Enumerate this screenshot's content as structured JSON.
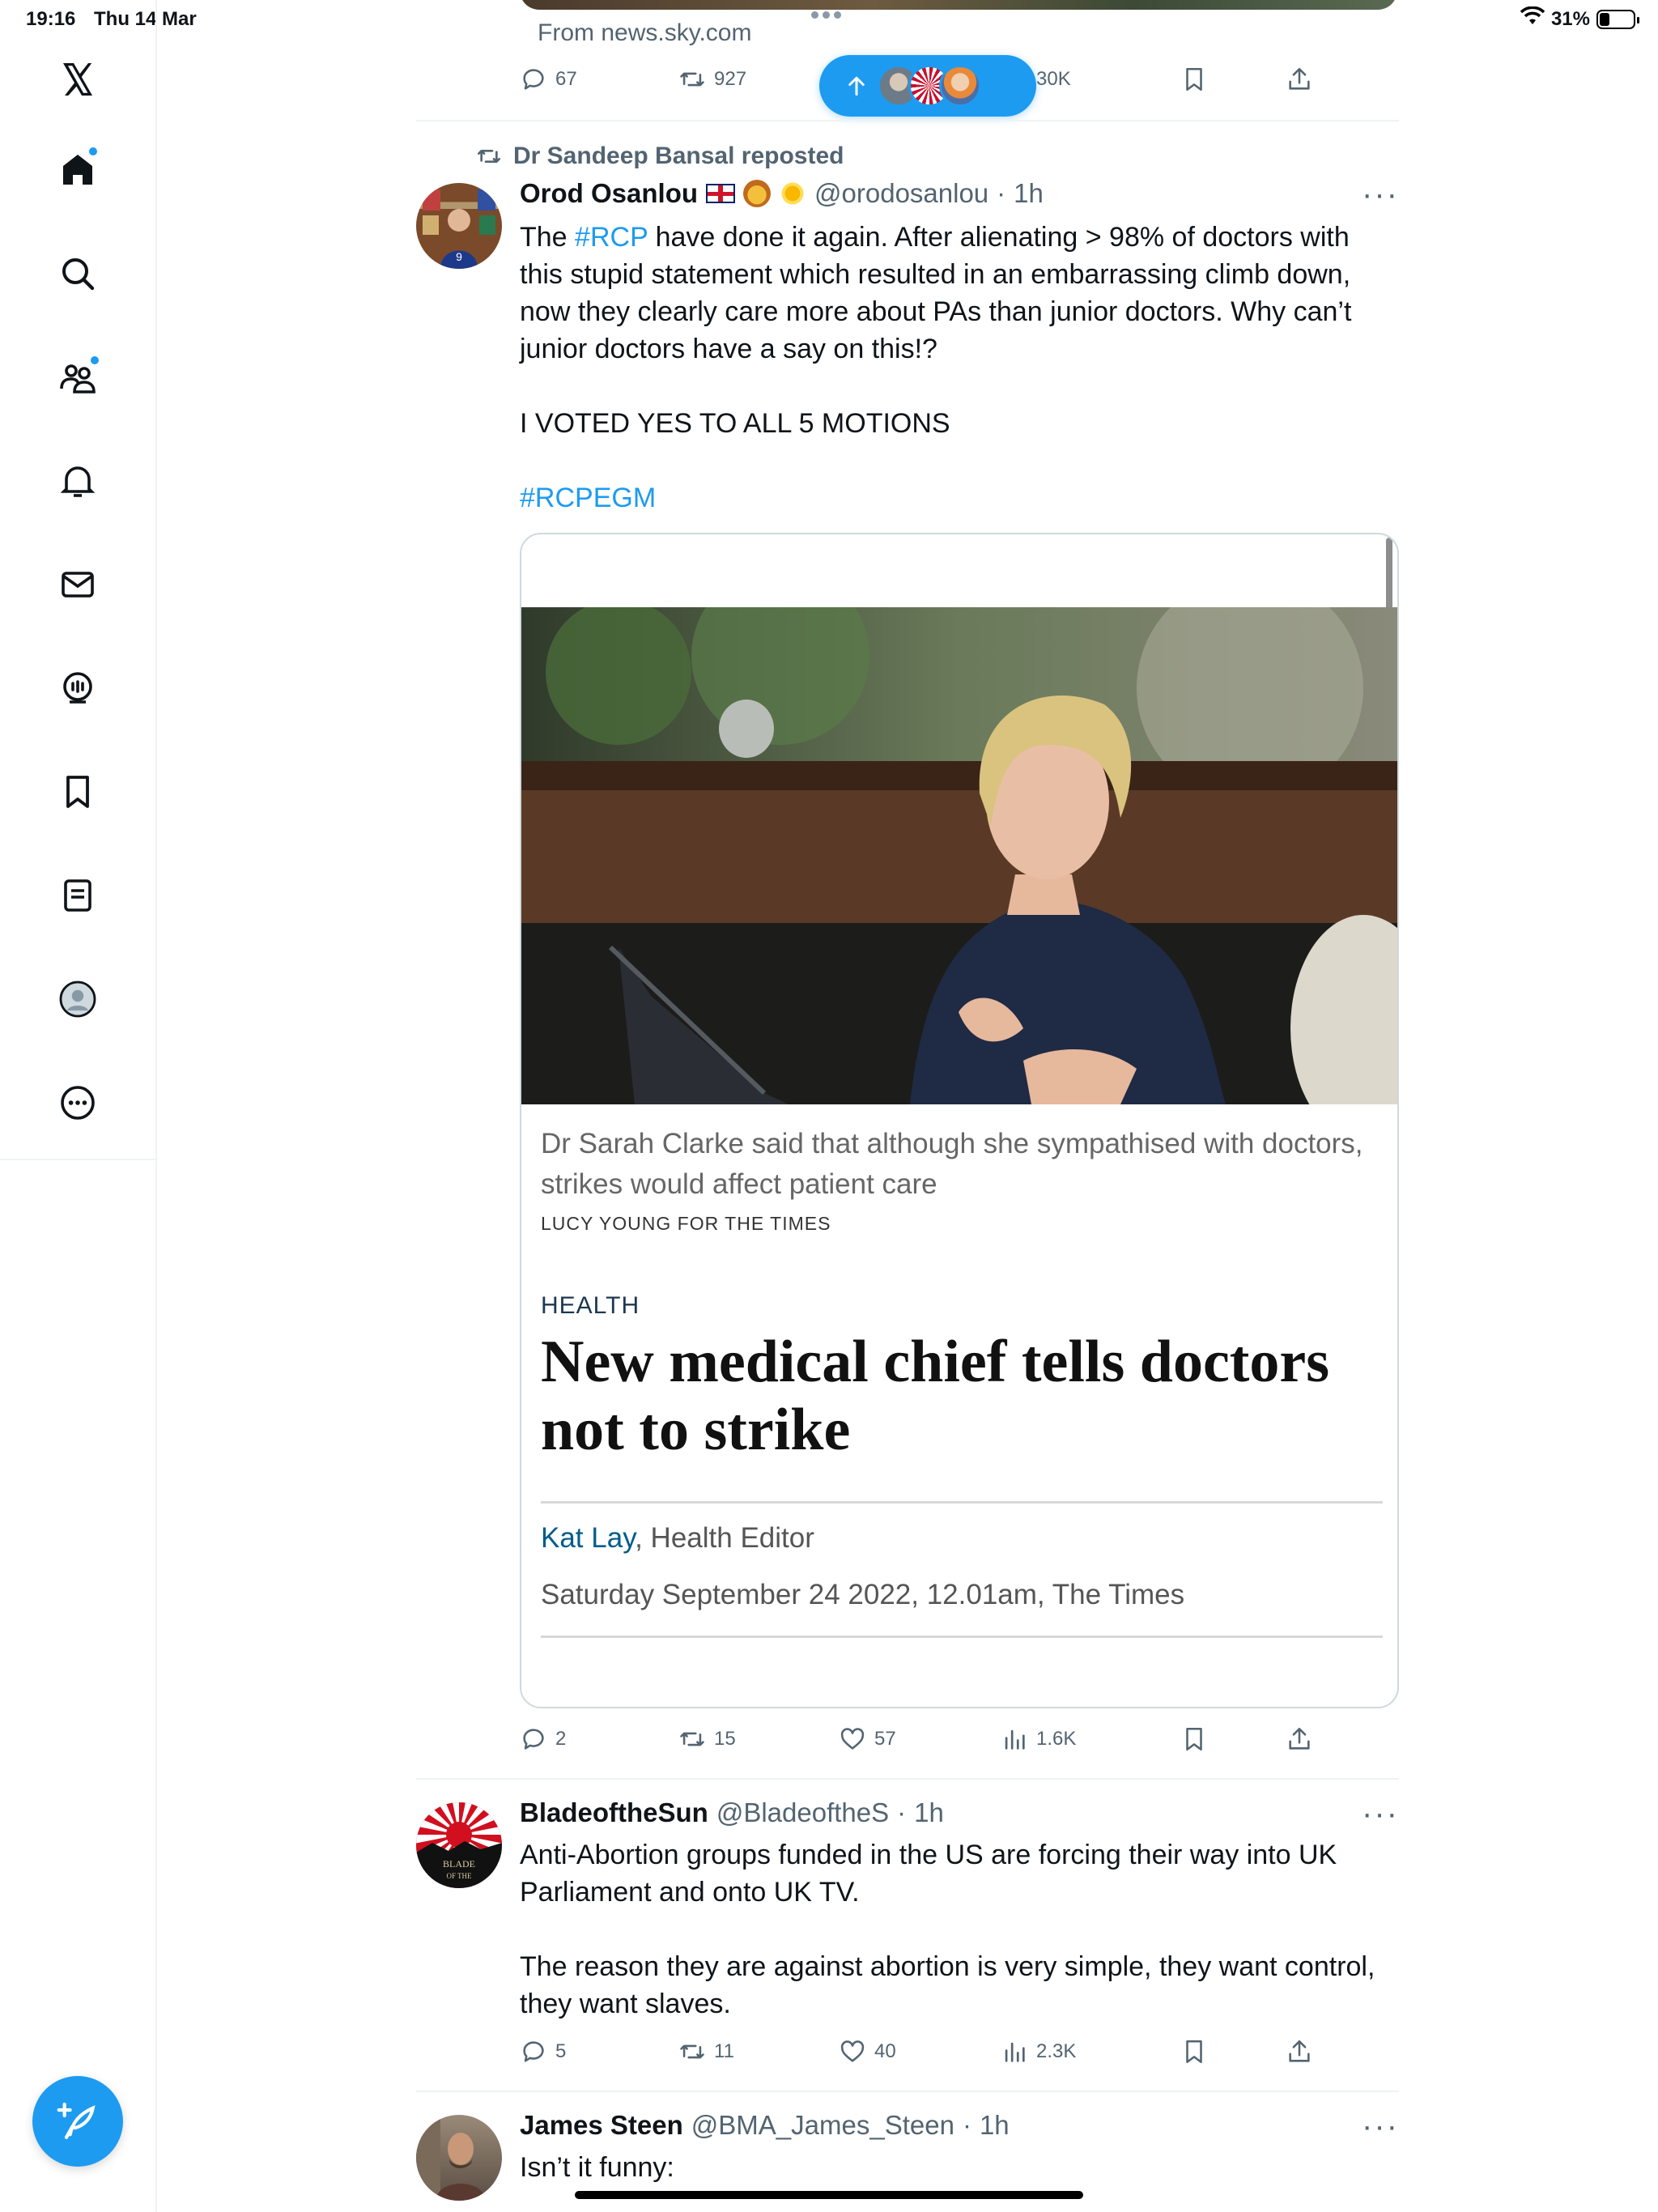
{
  "status_bar": {
    "time": "19:16",
    "date": "Thu 14 Mar",
    "battery": "31%",
    "battery_level": 0.31
  },
  "sidebar": {
    "items": [
      "x-logo",
      "home",
      "search",
      "communities",
      "notifications",
      "messages",
      "spaces",
      "bookmarks",
      "lists",
      "profile",
      "more"
    ]
  },
  "prev_tweet": {
    "source": "From news.sky.com",
    "replies": "67",
    "reposts": "927",
    "views": "30K"
  },
  "tweet1": {
    "reposted_by": "Dr Sandeep Bansal reposted",
    "name": "Orod Osanlou",
    "handle": "@orodosanlou",
    "sep": "·",
    "time": "1h",
    "text_before_tag": "The ",
    "tag1": "#RCP",
    "text_after_tag": " have done it again. After alienating > 98% of doctors with this stupid statement which resulted in an embarrassing climb down, now they clearly care more about PAs than junior doctors. Why can’t junior doctors have a say on this!?",
    "text2": "I VOTED YES TO ALL 5 MOTIONS",
    "tag2": "#RCPEGM",
    "card": {
      "caption": "Dr Sarah Clarke said that although she sympathised with doctors, strikes would affect patient care",
      "credit": "LUCY YOUNG FOR THE TIMES",
      "section": "HEALTH",
      "headline": "New medical chief tells doctors not to strike",
      "author": "Kat Lay",
      "author_role": ", Health Editor",
      "dateline": "Saturday September 24 2022, 12.01am, The Times"
    },
    "replies": "2",
    "reposts": "15",
    "likes": "57",
    "views": "1.6K"
  },
  "tweet2": {
    "name": "BladeoftheSun",
    "handle": "@BladeoftheS",
    "sep": "·",
    "time": "1h",
    "text1": "Anti-Abortion groups funded in the US are forcing their way into UK Parliament and onto UK TV.",
    "text2": "The reason they are against abortion is very simple, they want control, they want slaves.",
    "replies": "5",
    "reposts": "11",
    "likes": "40",
    "views": "2.3K"
  },
  "tweet3": {
    "name": "James Steen",
    "handle": "@BMA_James_Steen",
    "sep": "·",
    "time": "1h",
    "text": "Isn’t it funny:"
  },
  "more_label": "···",
  "colors": {
    "accent": "#1d9bf0",
    "secondary_text": "#536471",
    "divider": "#eff3f4"
  }
}
